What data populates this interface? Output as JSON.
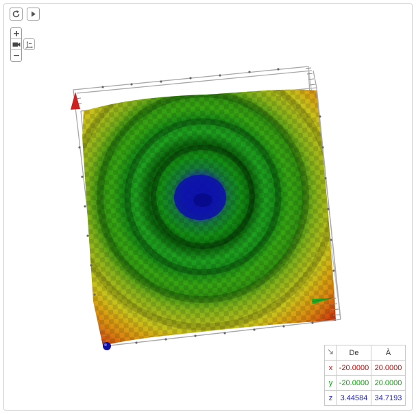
{
  "toolbar": {
    "reset_icon": "reset-view-icon",
    "play_icon": "play-icon",
    "zoom_in_icon": "plus-icon",
    "zoom_out_icon": "minus-icon",
    "camera_icon": "camera-icon",
    "rotate_icon": "rotate-axes-icon"
  },
  "bounds_table": {
    "corner_icon": "arrow-icon",
    "header_from": "De",
    "header_to": "À",
    "rows": [
      {
        "axis": "x",
        "from": "-20.0000",
        "to": "20.0000",
        "color": "#cc0000"
      },
      {
        "axis": "y",
        "from": "-20.0000",
        "to": "20.0000",
        "color": "#00aa00"
      },
      {
        "axis": "z",
        "from": "3.44584",
        "to": "34.7193",
        "color": "#1b1bd0"
      }
    ]
  },
  "colors": {
    "x_axis": "#cc2222",
    "y_axis": "#22aa22",
    "z_axis": "#1010a0"
  }
}
